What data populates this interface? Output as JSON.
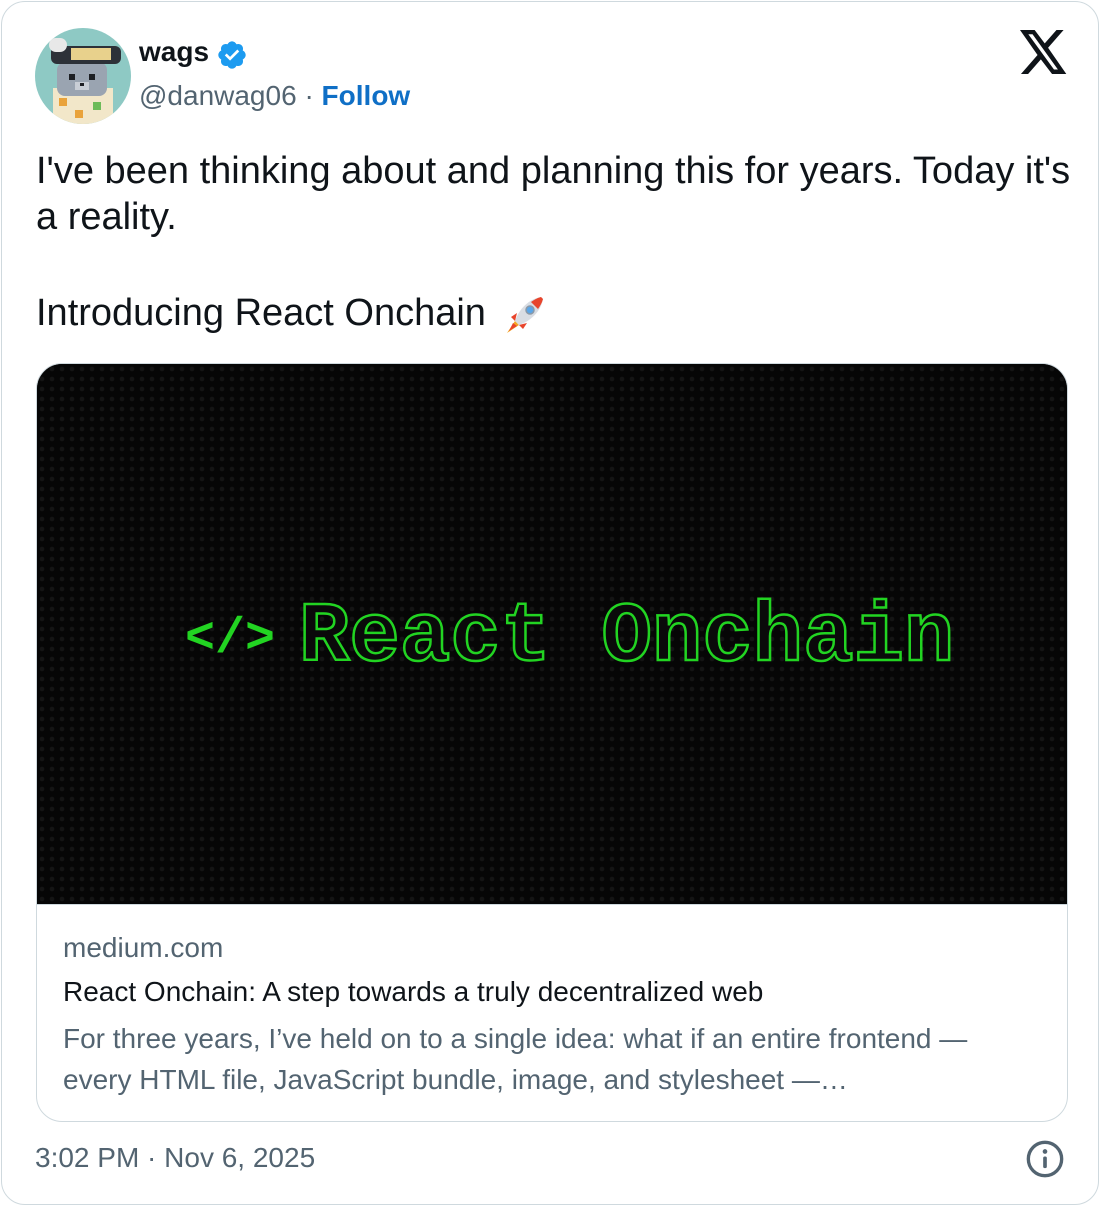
{
  "author": {
    "name": "wags",
    "handle": "@danwag06",
    "separator": "·",
    "follow_label": "Follow",
    "avatar_icon": "bear-avatar-icon",
    "verified_icon": "verified-badge-icon"
  },
  "platform_icon": "x-logo-icon",
  "tweet": {
    "line1": "I've been thinking about and planning this for years. Today it's a reality.",
    "line2": "Introducing React Onchain",
    "emoji_icon": "rocket-icon"
  },
  "link_card": {
    "image_title": "React Onchain",
    "image_code_glyph": "</>",
    "domain": "medium.com",
    "title": "React Onchain: A step towards a truly decentralized web",
    "description": "For three years, I’ve held on to a single idea: what if an entire frontend — every HTML file, JavaScript bundle, image, and stylesheet —…"
  },
  "timestamp": "3:02 PM · Nov 6, 2025",
  "info_icon": "info-icon",
  "colors": {
    "accent": "#0f6fc6",
    "verified": "#1d9bf0",
    "preview_green": "#22d422",
    "text_secondary": "#536471"
  }
}
